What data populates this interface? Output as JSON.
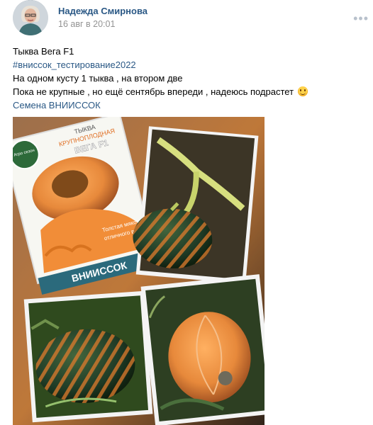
{
  "post": {
    "author": "Надежда Смирнова",
    "date": "16 авг в 20:01",
    "text_lines": [
      "Тыква Вега F1",
      "#вниссок_тестирование2022",
      "На одном кусту 1 тыква , на втором две",
      "Пока не крупные , но ещё сентябрь впереди , надеюсь подрастет",
      "Семена ВНИИССОК"
    ],
    "hashtag_line_index": 1,
    "link_line_index": 4,
    "emoji": "smiling-face-icon"
  },
  "photo": {
    "package_title_1": "ТЫКВА",
    "package_title_2": "КРУПНОПЛОДНАЯ",
    "package_variety": "ВЕГА F1",
    "package_brand": "ВНИИССОК",
    "package_caption_1": "Толстая мякоть",
    "package_caption_2": "отличного вкуса",
    "package_badge": "Агро сезон"
  },
  "colors": {
    "link": "#2a5885",
    "meta": "#939393"
  }
}
